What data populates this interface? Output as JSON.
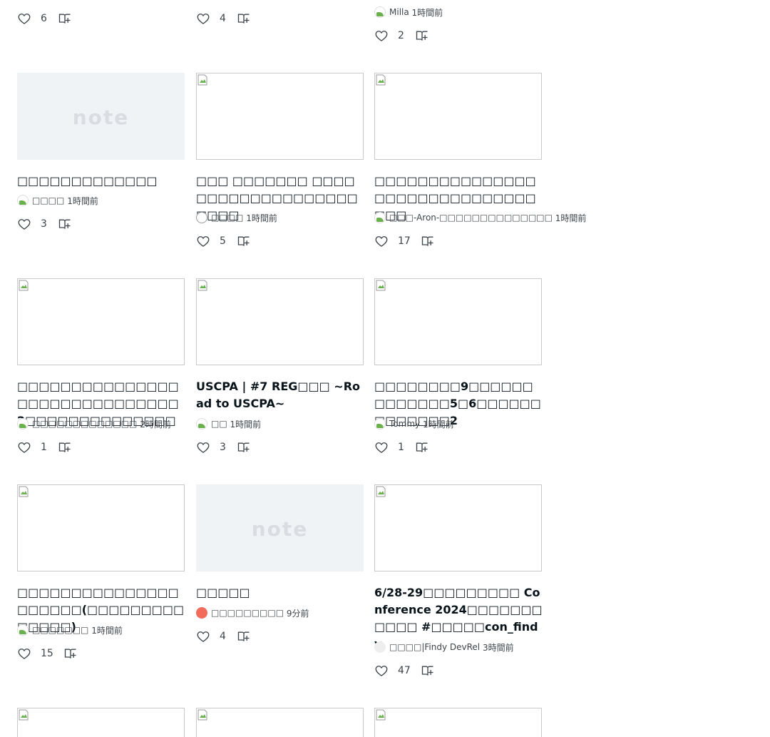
{
  "colors": {
    "placeholder_bg": "#f0f3f6",
    "text": "#08131a",
    "muted": "#3d4449"
  },
  "placeholder_logo": "note",
  "top_partial": [
    {
      "likes": "6"
    },
    {
      "likes": "4"
    },
    {
      "author": "Milla",
      "time": "1時間前",
      "likes": "2"
    }
  ],
  "cards": [
    {
      "title": "□□□□□□□□□□□□□",
      "author": "□□□□",
      "time": "1時間前",
      "likes": "3",
      "thumb": "note-placeholder",
      "avatar": "image-avatar"
    },
    {
      "title": "□□□ □□□□□□□ □□□□□□□□□□□□□□□□□□□□□□□",
      "author": "□□□□",
      "time": "1時間前",
      "likes": "5",
      "thumb": "broken-image",
      "avatar": "emblem-avatar"
    },
    {
      "title": "□□□□□□□□□□□□□□□□□□□□□□□□□□□□□□□□□",
      "author": "□□□-Aron-□□□□□□□□□□□□□□",
      "time": "1時間前",
      "likes": "17",
      "thumb": "broken-image",
      "avatar": "image-avatar"
    },
    {
      "title": "□□□□□□□□□□□□□□□□□□□□□□□□□□□□□□2□□□□□□□□□□□□□□",
      "author": "□□□□□□□□□□□□□",
      "time": "2時間前",
      "likes": "1",
      "thumb": "broken-image",
      "avatar": "image-avatar"
    },
    {
      "title": "USCPA | #7 REG□□□ ~Road to USCPA~",
      "author": "□□",
      "time": "1時間前",
      "likes": "3",
      "thumb": "broken-image",
      "avatar": "image-avatar"
    },
    {
      "title": "□□□□□□□□9□□□□□□□□□□□□□5□6□□□□□□□□□□□□□2",
      "author": "Tommy",
      "time": "1時間前",
      "likes": "1",
      "thumb": "broken-image",
      "avatar": "image-avatar"
    },
    {
      "title": "□□□□□□□□□□□□□□□□□□□□□(□□□□□□□□□□□□□□)",
      "author": "□□□□□□□",
      "time": "1時間前",
      "likes": "15",
      "thumb": "broken-image",
      "avatar": "image-avatar"
    },
    {
      "title": "□□□□□",
      "author": "□□□□□□□□□",
      "time": "9分前",
      "likes": "4",
      "thumb": "note-placeholder",
      "avatar": "smile-avatar"
    },
    {
      "title": "6/28-29□□□□□□□□□ Conference 2024□□□□□□□□□□□ #□□□□□con_findy",
      "author": "□□□□|Findy DevRel",
      "time": "3時間前",
      "likes": "47",
      "thumb": "broken-image",
      "avatar": "light-avatar"
    }
  ],
  "bottom_partial": [
    {
      "thumb": "broken-image"
    },
    {
      "thumb": "broken-image"
    },
    {
      "thumb": "broken-image"
    }
  ]
}
